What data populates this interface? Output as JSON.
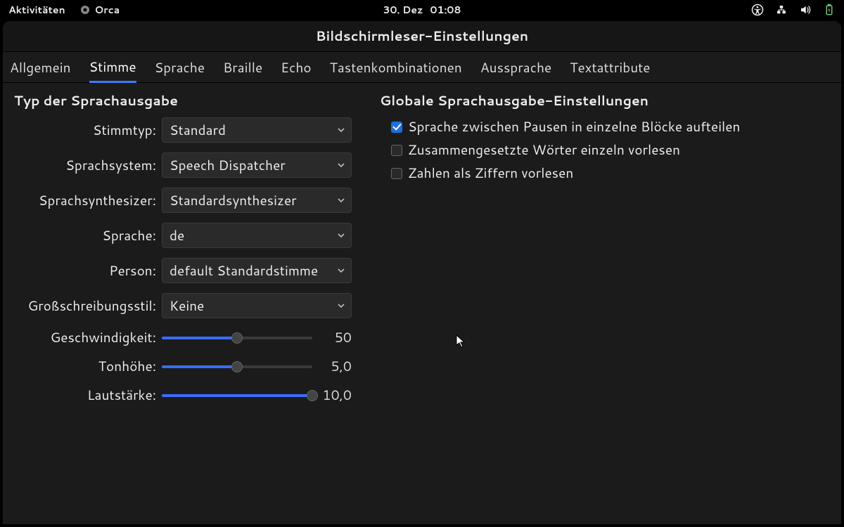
{
  "topbar": {
    "activities": "Aktivitäten",
    "app": "Orca",
    "date": "30. Dez",
    "time": "01:08"
  },
  "window": {
    "title": "Bildschirmleser-Einstellungen"
  },
  "tabs": [
    {
      "label": "Allgemein"
    },
    {
      "label": "Stimme",
      "active": true
    },
    {
      "label": "Sprache"
    },
    {
      "label": "Braille"
    },
    {
      "label": "Echo"
    },
    {
      "label": "Tastenkombinationen"
    },
    {
      "label": "Aussprache"
    },
    {
      "label": "Textattribute"
    }
  ],
  "left": {
    "heading": "Typ der Sprachausgabe",
    "rows": {
      "voice_type": {
        "label": "Stimmtyp:",
        "value": "Standard"
      },
      "speech_system": {
        "label": "Sprachsystem:",
        "value": "Speech Dispatcher"
      },
      "synthesizer": {
        "label": "Sprachsynthesizer:",
        "value": "Standardsynthesizer"
      },
      "language": {
        "label": "Sprache:",
        "value": "de"
      },
      "person": {
        "label": "Person:",
        "value": "default Standardstimme"
      },
      "capstyle": {
        "label": "Großschreibungsstil:",
        "value": "Keine"
      }
    },
    "sliders": {
      "rate": {
        "label": "Geschwindigkeit:",
        "value": "50",
        "pct": 50
      },
      "pitch": {
        "label": "Tonhöhe:",
        "value": "5,0",
        "pct": 50
      },
      "volume": {
        "label": "Lautstärke:",
        "value": "10,0",
        "pct": 100
      }
    }
  },
  "right": {
    "heading": "Globale Sprachausgabe-Einstellungen",
    "checks": {
      "pause_chunks": {
        "label": "Sprache zwischen Pausen in einzelne Blöcke aufteilen",
        "checked": true
      },
      "compound_words": {
        "label": "Zusammengesetzte Wörter einzeln vorlesen",
        "checked": false
      },
      "digits": {
        "label": "Zahlen als Ziffern vorlesen",
        "checked": false
      }
    }
  }
}
